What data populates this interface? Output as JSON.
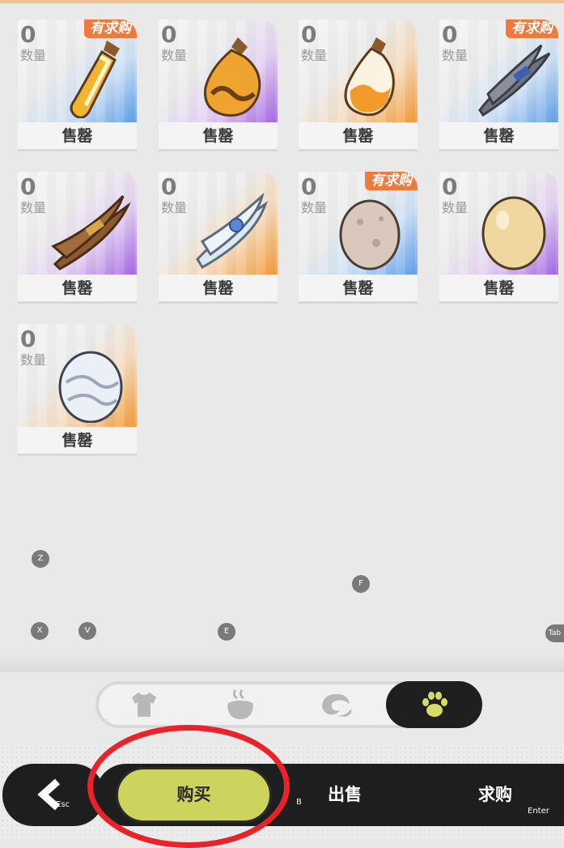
{
  "items": [
    {
      "qty": "0",
      "qty_label": "数量",
      "status": "售罄",
      "tag": "有求购",
      "rarity": "blue",
      "icon": "potion-small-icon"
    },
    {
      "qty": "0",
      "qty_label": "数量",
      "status": "售罄",
      "tag": "",
      "rarity": "purple",
      "icon": "potion-round-icon"
    },
    {
      "qty": "0",
      "qty_label": "数量",
      "status": "售罄",
      "tag": "",
      "rarity": "orange",
      "icon": "potion-flask-icon"
    },
    {
      "qty": "0",
      "qty_label": "数量",
      "status": "售罄",
      "tag": "有求购",
      "rarity": "blue",
      "icon": "dark-feather-bundle-icon"
    },
    {
      "qty": "0",
      "qty_label": "数量",
      "status": "售罄",
      "tag": "",
      "rarity": "purple",
      "icon": "brown-fiber-bundle-icon"
    },
    {
      "qty": "0",
      "qty_label": "数量",
      "status": "售罄",
      "tag": "",
      "rarity": "orange",
      "icon": "white-fiber-bundle-icon"
    },
    {
      "qty": "0",
      "qty_label": "数量",
      "status": "售罄",
      "tag": "有求购",
      "rarity": "blue",
      "icon": "grey-egg-icon"
    },
    {
      "qty": "0",
      "qty_label": "数量",
      "status": "售罄",
      "tag": "",
      "rarity": "purple",
      "icon": "yellow-egg-icon"
    },
    {
      "qty": "0",
      "qty_label": "数量",
      "status": "售罄",
      "tag": "",
      "rarity": "orange",
      "icon": "swirl-egg-icon"
    }
  ],
  "hotkeys": {
    "z": "Z",
    "f": "F",
    "x": "X",
    "v": "V",
    "e": "E",
    "tab": "Tab",
    "esc": "Esc",
    "b": "B",
    "enter": "Enter"
  },
  "categories": [
    {
      "icon": "shirt-icon",
      "active": false
    },
    {
      "icon": "food-bowl-icon",
      "active": false
    },
    {
      "icon": "swirl-material-icon",
      "active": false
    },
    {
      "icon": "paw-icon",
      "active": true
    }
  ],
  "nav": {
    "buy": "购买",
    "sell": "出售",
    "request": "求购"
  },
  "colors": {
    "tag": "#ef7a3e",
    "buy_button": "#cdd45e",
    "blue": "#5e9ee9",
    "purple": "#a467e4",
    "orange": "#f49a35",
    "annotation_ring": "#e8242a"
  }
}
